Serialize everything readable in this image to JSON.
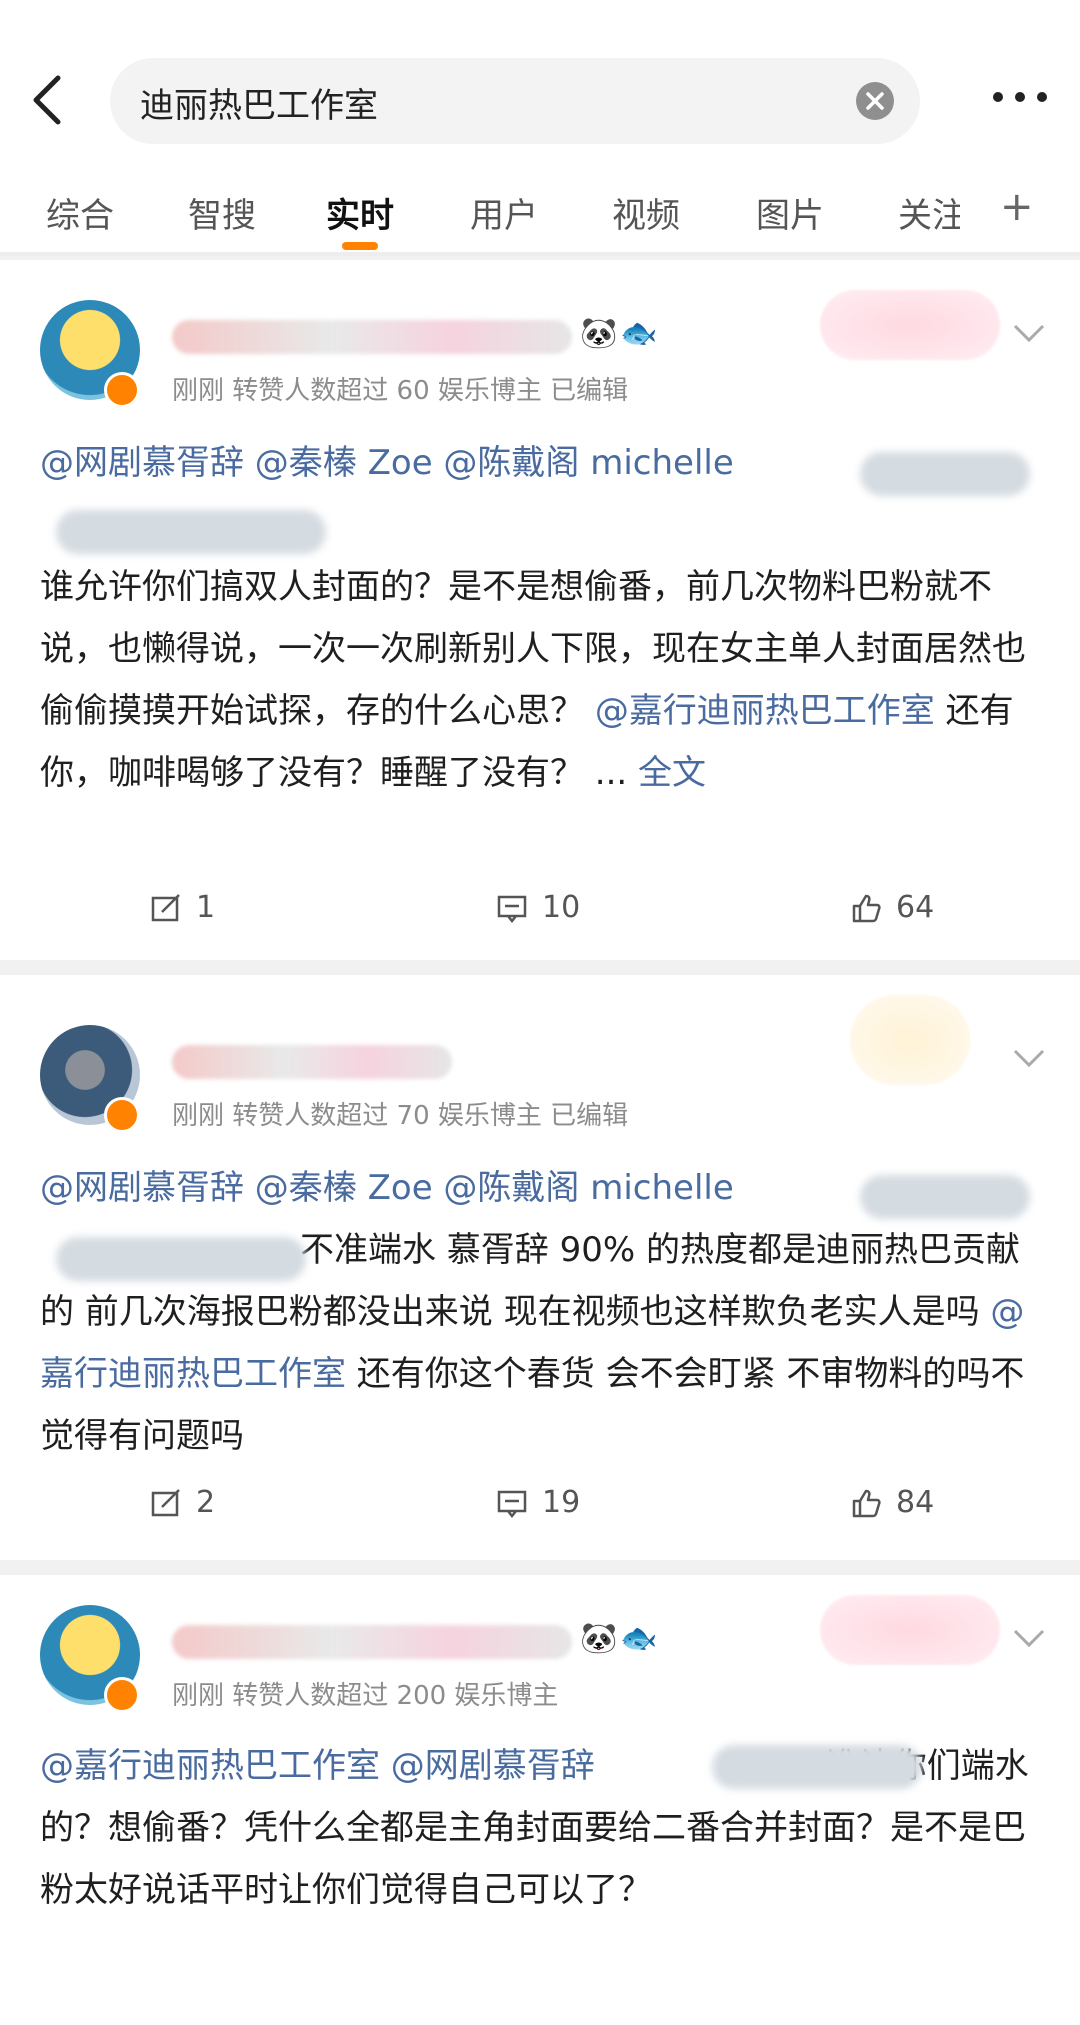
{
  "header": {
    "search_query": "迪丽热巴工作室",
    "tabs": [
      "综合",
      "智搜",
      "实时",
      "用户",
      "视频",
      "图片",
      "关注"
    ],
    "active_tab": "实时"
  },
  "posts": [
    {
      "meta": "刚刚 转赞人数超过 60 娱乐博主 已编辑",
      "line1": "@网剧慕胥辞 @秦榛 Zoe @陈戴阁 michelle",
      "body": "谁允许你们搞双人封面的？是不是想偷番，前几次物料巴粉就不说，也懒得说，一次一次刷新别人下限，现在女主单人封面居然也偷偷摸摸开始试探，存的什么心思？",
      "mention": "@嘉行迪丽热巴工作室",
      "body_tail": " 还有你，咖啡喝够了没有？睡醒了没有？ ... ",
      "full_link": "全文",
      "reposts": "1",
      "comments": "10",
      "likes": "64"
    },
    {
      "meta": "刚刚 转赞人数超过 70 娱乐博主 已编辑",
      "line1": "@网剧慕胥辞 @秦榛 Zoe @陈戴阁 michelle",
      "body": "不准端水 慕胥辞 90% 的热度都是迪丽热巴贡献的 前几次海报巴粉都没出来说 现在视频也这样欺负老实人是吗 ",
      "mention": "@嘉行迪丽热巴工作室",
      "body_tail": " 还有你这个春货 会不会盯紧 不审物料的吗不觉得有问题吗",
      "reposts": "2",
      "comments": "19",
      "likes": "84"
    },
    {
      "meta": "刚刚 转赞人数超过 200 娱乐博主",
      "line1": "@嘉行迪丽热巴工作室 @网剧慕胥辞",
      "body": "谁让你们端水的？想偷番？凭什么全都是主角封面要给二番合并封面？是不是巴粉太好说话平时让你们觉得自己可以了？"
    }
  ]
}
